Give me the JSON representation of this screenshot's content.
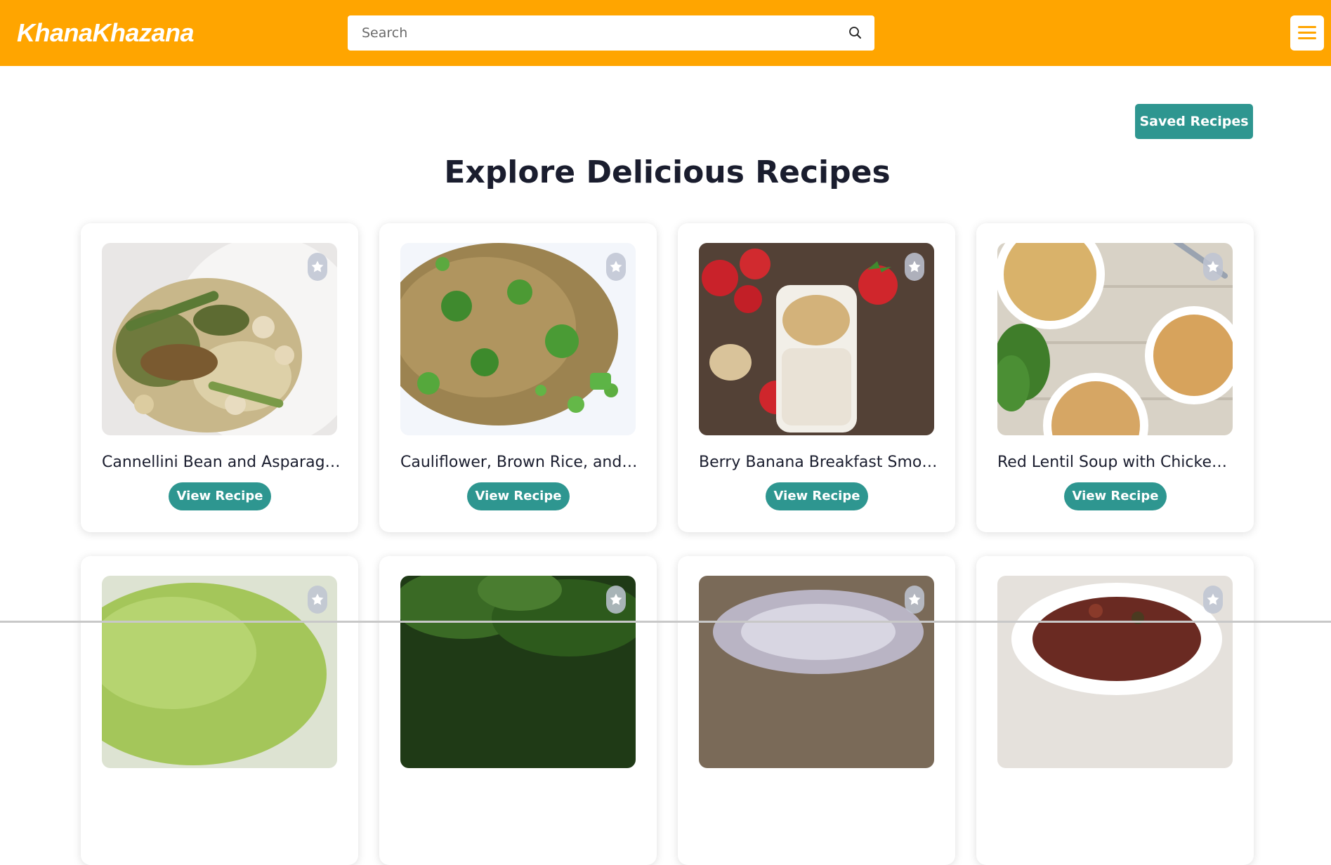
{
  "app": {
    "logo": "KhanaKhazana",
    "accent_color": "#FFA500",
    "button_color": "#2E9690"
  },
  "search": {
    "placeholder": "Search",
    "icon": "search-icon"
  },
  "menu": {
    "icon": "hamburger-menu-icon"
  },
  "saved_recipes_label": "Saved Recipes",
  "page_title": "Explore Delicious Recipes",
  "view_recipe_label": "View Recipe",
  "recipes": [
    {
      "title": "Cannellini Bean and Asparagus Salad with Mushrooms",
      "image": "bean-asparagus-mushroom-dish"
    },
    {
      "title": "Cauliflower, Brown Rice, and Vegetable Fried Rice",
      "image": "brown-rice-broccoli-peas"
    },
    {
      "title": "Berry Banana Breakfast Smoothie",
      "image": "smoothie-with-strawberries"
    },
    {
      "title": "Red Lentil Soup with Chicken and Turnips",
      "image": "lentil-soup-bowls"
    },
    {
      "title": "",
      "image": "green-soup"
    },
    {
      "title": "",
      "image": "kale-greens"
    },
    {
      "title": "",
      "image": "bowl-dessert"
    },
    {
      "title": "",
      "image": "bean-stew"
    }
  ]
}
